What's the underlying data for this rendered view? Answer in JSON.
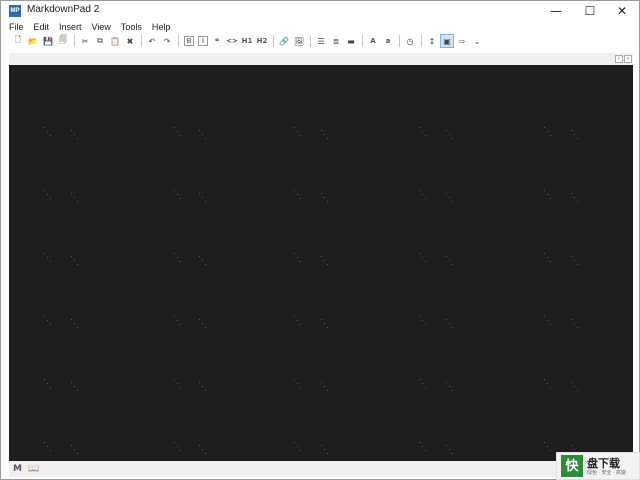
{
  "window": {
    "title": "MarkdownPad 2",
    "app_icon_text": "MP",
    "minimize_label": "—",
    "maximize_label": "☐",
    "close_label": "✕"
  },
  "menu": {
    "items": [
      "File",
      "Edit",
      "Insert",
      "View",
      "Tools",
      "Help"
    ]
  },
  "toolbar": {
    "bold": "B",
    "italic": "I",
    "quote": "❝",
    "code": "<>",
    "h1": "H1",
    "h2": "H2",
    "uppercase": "A",
    "lowercase": "a"
  },
  "status": {
    "markdown_icon": "M",
    "preview_icon": "📖"
  },
  "watermark": {
    "logo": "快",
    "text": "盘下载",
    "sub": "绿色 · 安全 · 高速"
  }
}
